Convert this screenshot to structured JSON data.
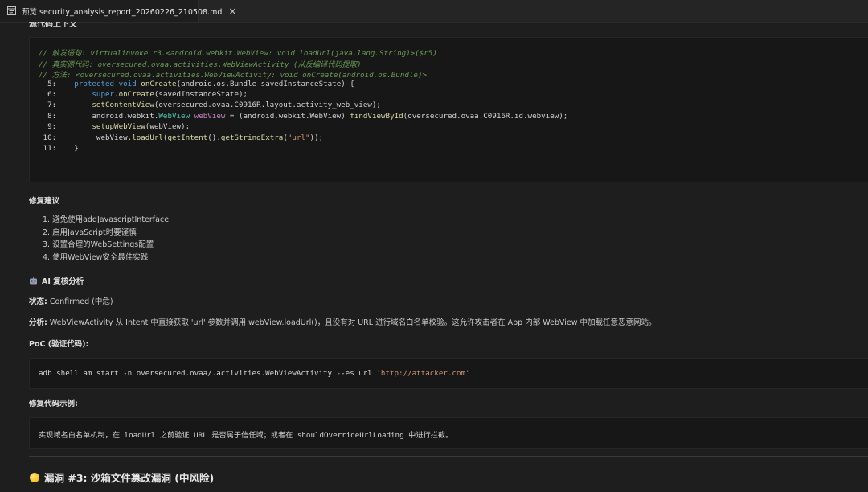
{
  "tab": {
    "title": "预览 security_analysis_report_20260226_210508.md",
    "close": "×",
    "icon": "preview-icon"
  },
  "cut_heading": "源代码上下文",
  "code": {
    "comments": [
      "// 触发语句: virtualinvoke r3.<android.webkit.WebView: void loadUrl(java.lang.String)>($r5)",
      "// 真实源代码: oversecured.ovaa.activities.WebViewActivity (从反编译代码提取)",
      "// 方法: <oversecured.ovaa.activities.WebViewActivity: void onCreate(android.os.Bundle)>"
    ],
    "lines": [
      {
        "num": "5:",
        "indent": "    ",
        "parts": [
          [
            "kw",
            "protected"
          ],
          [
            "p",
            " "
          ],
          [
            "kw",
            "void"
          ],
          [
            "p",
            " "
          ],
          [
            "fn",
            "onCreate"
          ],
          [
            "p",
            "(android.os.Bundle savedInstanceState) {"
          ]
        ]
      },
      {
        "num": "6:",
        "indent": "        ",
        "parts": [
          [
            "kw",
            "super"
          ],
          [
            "p",
            "."
          ],
          [
            "fn",
            "onCreate"
          ],
          [
            "p",
            "(savedInstanceState);"
          ]
        ]
      },
      {
        "num": "7:",
        "indent": "        ",
        "parts": [
          [
            "fn",
            "setContentView"
          ],
          [
            "p",
            "(oversecured.ovaa.C0916R.layout.activity_web_view);"
          ]
        ]
      },
      {
        "num": "8:",
        "indent": "        ",
        "parts": [
          [
            "p",
            "android.webkit."
          ],
          [
            "ty",
            "WebView"
          ],
          [
            "p",
            " "
          ],
          [
            "var",
            "webView"
          ],
          [
            "p",
            " = (android.webkit.WebView) "
          ],
          [
            "fn",
            "findViewById"
          ],
          [
            "p",
            "(oversecured.ovaa.C0916R.id.webview);"
          ]
        ]
      },
      {
        "num": "9:",
        "indent": "        ",
        "parts": [
          [
            "fn",
            "setupWebView"
          ],
          [
            "p",
            "(webView);"
          ]
        ]
      },
      {
        "num": "10:",
        "indent": "         ",
        "parts": [
          [
            "p",
            "webView."
          ],
          [
            "fn",
            "loadUrl"
          ],
          [
            "p",
            "("
          ],
          [
            "fn",
            "getIntent"
          ],
          [
            "p",
            "()."
          ],
          [
            "fn",
            "getStringExtra"
          ],
          [
            "p",
            "("
          ],
          [
            "str",
            "\"url\""
          ],
          [
            "p",
            "));"
          ]
        ]
      },
      {
        "num": "11:",
        "indent": "    ",
        "parts": [
          [
            "p",
            "}"
          ]
        ]
      }
    ]
  },
  "fix_heading": "修复建议",
  "fix_items": [
    "1. 避免使用addJavascriptInterface",
    "2. 启用JavaScript时要谨慎",
    "3. 设置合理的WebSettings配置",
    "4. 使用WebView安全最佳实践"
  ],
  "ai": {
    "icon": "robot-icon",
    "heading": "AI 复核分析",
    "status_label": "状态:",
    "status_value": " Confirmed (中危)",
    "analysis_label": "分析:",
    "analysis_value": " WebViewActivity 从 Intent 中直接获取 'url' 参数并调用 webView.loadUrl()，且没有对 URL 进行域名白名单校验。这允许攻击者在 App 内部 WebView 中加载任意恶意网站。",
    "poc_label": "PoC (验证代码):",
    "poc_code_plain": "adb shell am start -n oversecured.ovaa/.activities.WebViewActivity --es url ",
    "poc_code_str": "'http://attacker.com'",
    "fix_example_label": "修复代码示例:",
    "fix_example": "实现域名白名单机制，在 loadUrl 之前验证 URL 是否属于信任域；或者在 shouldOverrideUrlLoading 中进行拦截。"
  },
  "next_section": {
    "icon": "yellow-circle-icon",
    "title": "漏洞 #3: 沙箱文件篡改漏洞 (中风险)"
  }
}
